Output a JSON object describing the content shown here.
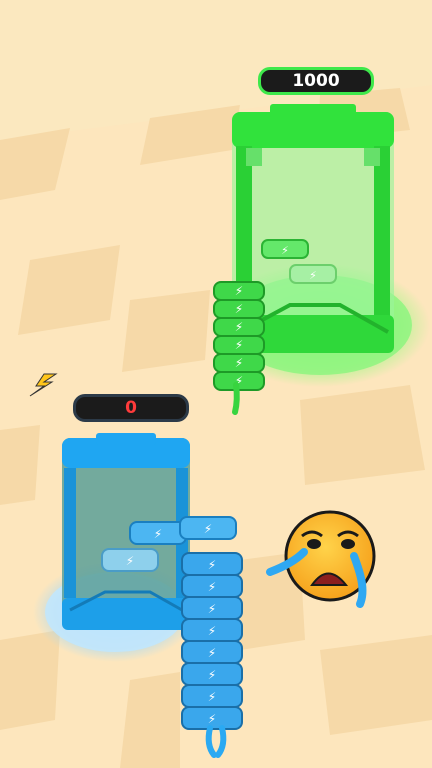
{
  "hud": {
    "player_score": "0",
    "rival_score": "1000"
  },
  "colors": {
    "sky": "#fbe8bf",
    "floor_light": "#fde6bd",
    "floor_dark": "#f6d9a8",
    "rival_green": "#31e23c",
    "player_blue": "#1fa6f2",
    "counter_bg": "#1b1b1b",
    "player_score_text": "#ff3b3b",
    "rival_score_text": "#ffffff"
  },
  "icons": {
    "battery": "battery-icon",
    "energy": "lightning-icon",
    "emoji": "crying-face-icon"
  },
  "stacks": {
    "player_battery_count": 8,
    "rival_battery_count": 6,
    "player_tank_batteries": 2,
    "rival_tank_batteries": 2
  }
}
